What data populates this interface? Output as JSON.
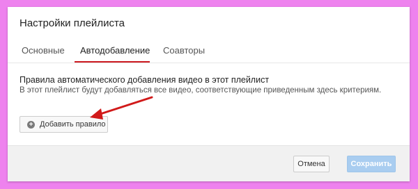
{
  "dialog": {
    "title": "Настройки плейлиста"
  },
  "tabs": [
    {
      "label": "Основные",
      "active": false
    },
    {
      "label": "Автодобавление",
      "active": true
    },
    {
      "label": "Соавторы",
      "active": false
    }
  ],
  "content": {
    "heading": "Правила автоматического добавления видео в этот плейлист",
    "description": "В этот плейлист будут добавляться все видео, соответствующие приведенным здесь критериям.",
    "add_rule_label": "Добавить правило",
    "add_rule_icon": "plus-circle-icon"
  },
  "footer": {
    "cancel_label": "Отмена",
    "save_label": "Сохранить",
    "save_disabled": true
  },
  "colors": {
    "background": "#ee82ee",
    "tab_accent": "#cc181e",
    "annotation_arrow": "#d11a1a",
    "save_button": "#a9cdf0"
  }
}
